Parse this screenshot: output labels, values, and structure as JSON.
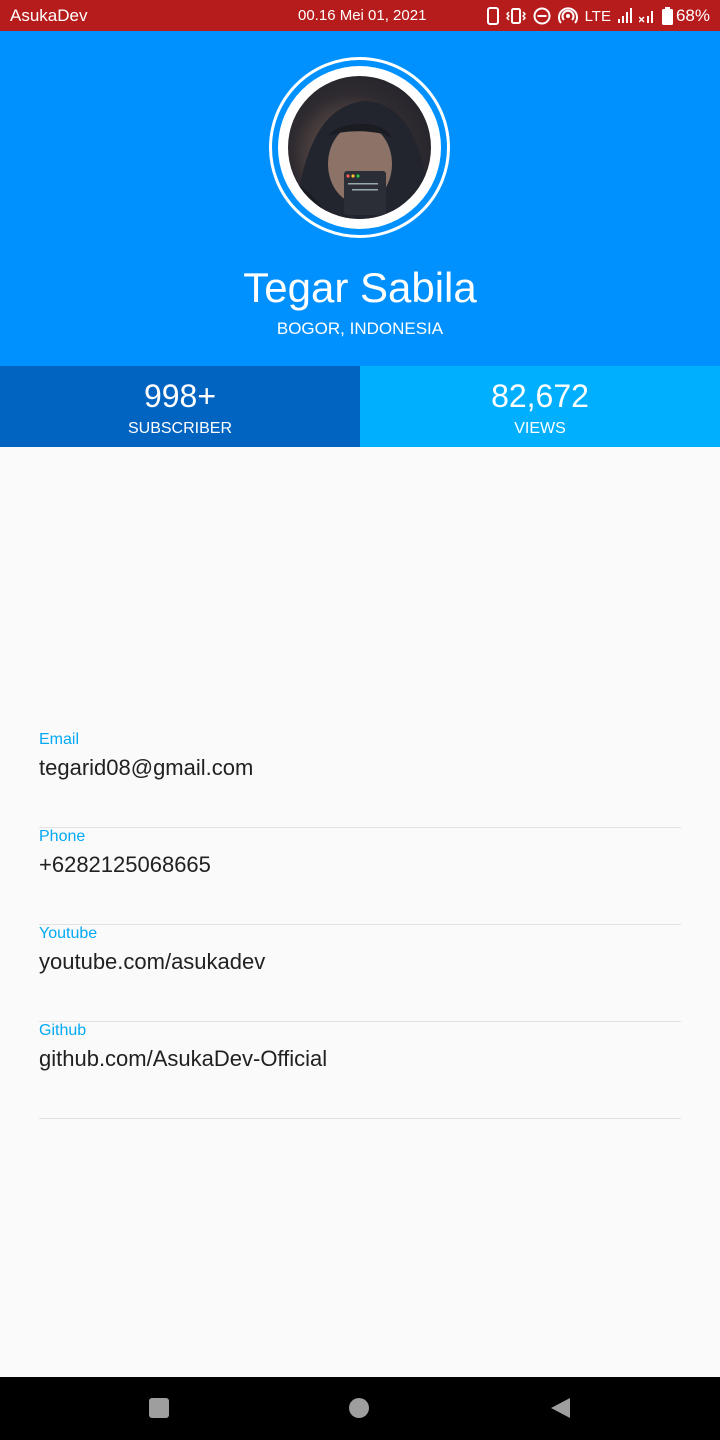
{
  "status_bar": {
    "carrier": "AsukaDev",
    "datetime": "00.16 Mei 01, 2021",
    "network": "LTE",
    "battery": "68%",
    "icons": [
      "phone-icon",
      "vibrate-icon",
      "dnd-icon",
      "hotspot-icon",
      "signal-icon",
      "no-signal-icon",
      "battery-icon"
    ]
  },
  "profile": {
    "name": "Tegar Sabila",
    "location": "BOGOR, INDONESIA"
  },
  "stats": [
    {
      "value": "998+",
      "label": "SUBSCRIBER"
    },
    {
      "value": "82,672",
      "label": "VIEWS"
    }
  ],
  "info": [
    {
      "label": "Email",
      "value": "tegarid08@gmail.com"
    },
    {
      "label": "Phone",
      "value": "+6282125068665"
    },
    {
      "label": "Youtube",
      "value": "youtube.com/asukadev"
    },
    {
      "label": "Github",
      "value": "github.com/AsukaDev-Official"
    }
  ],
  "nav": {
    "buttons": [
      "recents-icon",
      "home-icon",
      "back-icon"
    ]
  },
  "colors": {
    "status_bar": "#b71c1c",
    "header": "#0091ff",
    "stat_left": "#0064c0",
    "stat_right": "#00b0ff",
    "info_label": "#03a9f4"
  }
}
